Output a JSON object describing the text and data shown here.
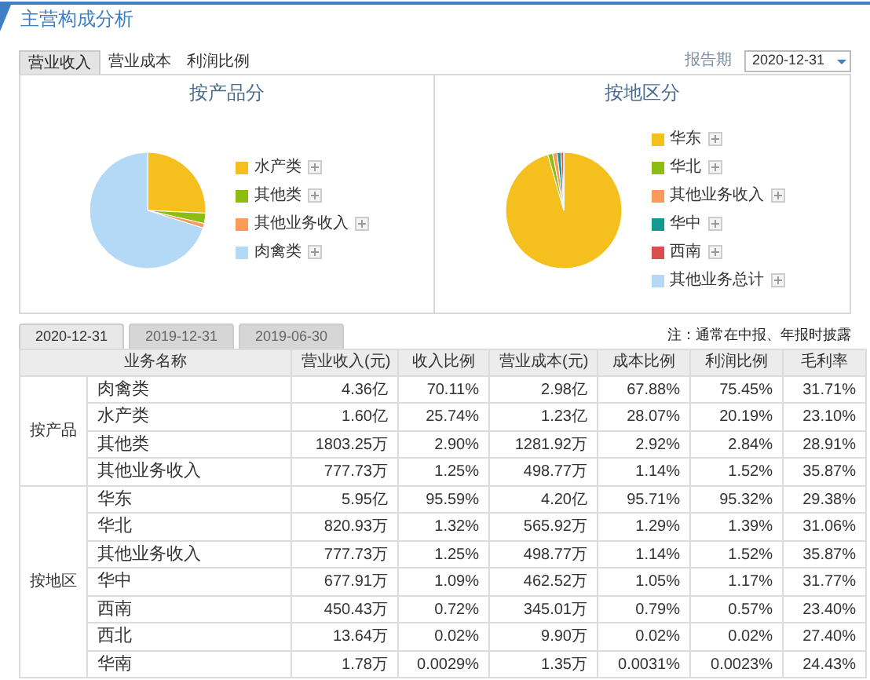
{
  "title": "主营构成分析",
  "tabs": [
    {
      "label": "营业收入",
      "selected": true
    },
    {
      "label": "营业成本",
      "selected": false
    },
    {
      "label": "利润比例",
      "selected": false
    }
  ],
  "report_period": {
    "label": "报告期",
    "value": "2020-12-31"
  },
  "charts": [
    {
      "chart_data": {
        "type": "pie",
        "title": "按产品分",
        "categories": [
          "水产类",
          "其他类",
          "其他业务收入",
          "肉禽类"
        ],
        "values": [
          25.74,
          2.9,
          1.25,
          70.11
        ],
        "colors": [
          "#f5c01e",
          "#8dbd13",
          "#fb9a5a",
          "#b3d9f6"
        ]
      }
    },
    {
      "chart_data": {
        "type": "pie",
        "title": "按地区分",
        "categories": [
          "华东",
          "华北",
          "其他业务收入",
          "华中",
          "西南",
          "其他业务总计"
        ],
        "values": [
          95.59,
          1.32,
          1.25,
          1.09,
          0.72,
          0.03
        ],
        "colors": [
          "#f5c01e",
          "#8dbd13",
          "#fb9a5a",
          "#139a91",
          "#d94f4f",
          "#b3d9f6"
        ]
      }
    }
  ],
  "date_tabs": [
    {
      "label": "2020-12-31",
      "selected": true
    },
    {
      "label": "2019-12-31",
      "selected": false
    },
    {
      "label": "2019-06-30",
      "selected": false
    }
  ],
  "note": "注：通常在中报、年报时披露",
  "table": {
    "columns": [
      "业务名称",
      "营业收入(元)",
      "收入比例",
      "营业成本(元)",
      "成本比例",
      "利润比例",
      "毛利率"
    ],
    "groups": [
      {
        "name": "按产品",
        "rows": [
          [
            "肉禽类",
            "4.36亿",
            "70.11%",
            "2.98亿",
            "67.88%",
            "75.45%",
            "31.71%"
          ],
          [
            "水产类",
            "1.60亿",
            "25.74%",
            "1.23亿",
            "28.07%",
            "20.19%",
            "23.10%"
          ],
          [
            "其他类",
            "1803.25万",
            "2.90%",
            "1281.92万",
            "2.92%",
            "2.84%",
            "28.91%"
          ],
          [
            "其他业务收入",
            "777.73万",
            "1.25%",
            "498.77万",
            "1.14%",
            "1.52%",
            "35.87%"
          ]
        ]
      },
      {
        "name": "按地区",
        "rows": [
          [
            "华东",
            "5.95亿",
            "95.59%",
            "4.20亿",
            "95.71%",
            "95.32%",
            "29.38%"
          ],
          [
            "华北",
            "820.93万",
            "1.32%",
            "565.92万",
            "1.29%",
            "1.39%",
            "31.06%"
          ],
          [
            "其他业务收入",
            "777.73万",
            "1.25%",
            "498.77万",
            "1.14%",
            "1.52%",
            "35.87%"
          ],
          [
            "华中",
            "677.91万",
            "1.09%",
            "462.52万",
            "1.05%",
            "1.17%",
            "31.77%"
          ],
          [
            "西南",
            "450.43万",
            "0.72%",
            "345.01万",
            "0.79%",
            "0.57%",
            "23.40%"
          ],
          [
            "西北",
            "13.64万",
            "0.02%",
            "9.90万",
            "0.02%",
            "0.02%",
            "27.40%"
          ],
          [
            "华南",
            "1.78万",
            "0.0029%",
            "1.35万",
            "0.0031%",
            "0.0023%",
            "24.43%"
          ]
        ]
      }
    ]
  }
}
